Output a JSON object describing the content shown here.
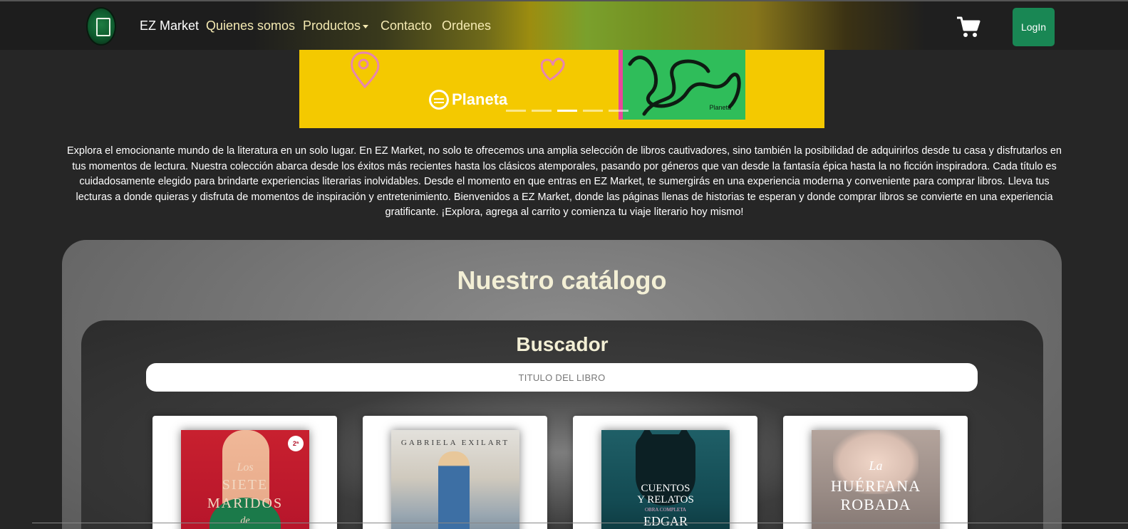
{
  "navbar": {
    "brand": "EZ Market",
    "links": [
      "Quienes somos",
      "Productos",
      "Contacto",
      "Ordenes"
    ],
    "login_label": "LogIn",
    "icons": {
      "logo": "store-logo-icon",
      "cart": "shopping-cart-icon",
      "dropdown": "caret-down-icon"
    }
  },
  "banner": {
    "brand_text": "Planeta",
    "book_brand": "Planeta",
    "slide_count": 5,
    "active_slide": 3
  },
  "intro_text": "Explora el emocionante mundo de la literatura en un solo lugar. En EZ Market, no solo te ofrecemos una amplia selección de libros cautivadores, sino también la posibilidad de adquirirlos desde tu casa y disfrutarlos en tus momentos de lectura. Nuestra colección abarca desde los éxitos más recientes hasta los clásicos atemporales, pasando por géneros que van desde la fantasía épica hasta la no ficción inspiradora. Cada título es cuidadosamente elegido para brindarte experiencias literarias inolvidables. Desde el momento en que entras en EZ Market, te sumergirás en una experiencia moderna y conveniente para comprar libros. Lleva tus lecturas a donde quieras y disfruta de momentos de inspiración y entretenimiento. Bienvenidos a EZ Market, donde las páginas llenas de historias te esperan y donde comprar libros se convierte en una experiencia gratificante. ¡Explora, agrega al carrito y comienza tu viaje literario hoy mismo!",
  "catalog": {
    "title": "Nuestro catálogo",
    "search": {
      "title": "Buscador",
      "placeholder": "TITULO DEL LIBRO"
    },
    "books": [
      {
        "cover_lines": [
          "Los",
          "SIETE",
          "MARIDOS",
          "de"
        ],
        "badge": "2ª"
      },
      {
        "cover_lines": [
          "GABRIELA EXILART"
        ]
      },
      {
        "cover_lines": [
          "CUENTOS",
          "Y RELATOS",
          "OBRA COMPLETA",
          "EDGAR"
        ]
      },
      {
        "cover_lines": [
          "La",
          "HUÉRFANA",
          "ROBADA"
        ]
      }
    ]
  },
  "colors": {
    "background": "#262626",
    "banner_yellow": "#f4c900",
    "login_green": "#198754",
    "heading_cream": "#f3efd5"
  }
}
